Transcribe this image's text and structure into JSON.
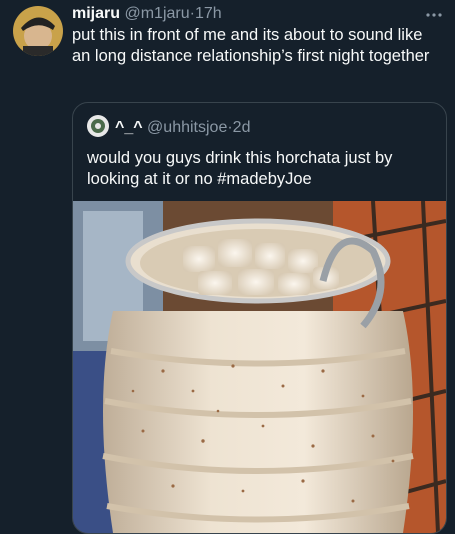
{
  "tweet": {
    "name": "mijaru",
    "handle": "@m1jaru",
    "separator": "·",
    "time": "17h",
    "text": "put this in front of me and its about to sound like an long distance relationship’s first night together",
    "more_icon": "more-icon"
  },
  "quote": {
    "name": "^_^",
    "handle": "@uhhitsjoe",
    "separator": "·",
    "time": "2d",
    "text": "would you guys drink this horchata just by looking at it or no #madebyJoe",
    "media_icon": "horchata-jar-photo"
  },
  "colors": {
    "background": "#15202b",
    "text": "#f7f9f9",
    "secondary": "#8b98a5",
    "border": "#38444d"
  }
}
